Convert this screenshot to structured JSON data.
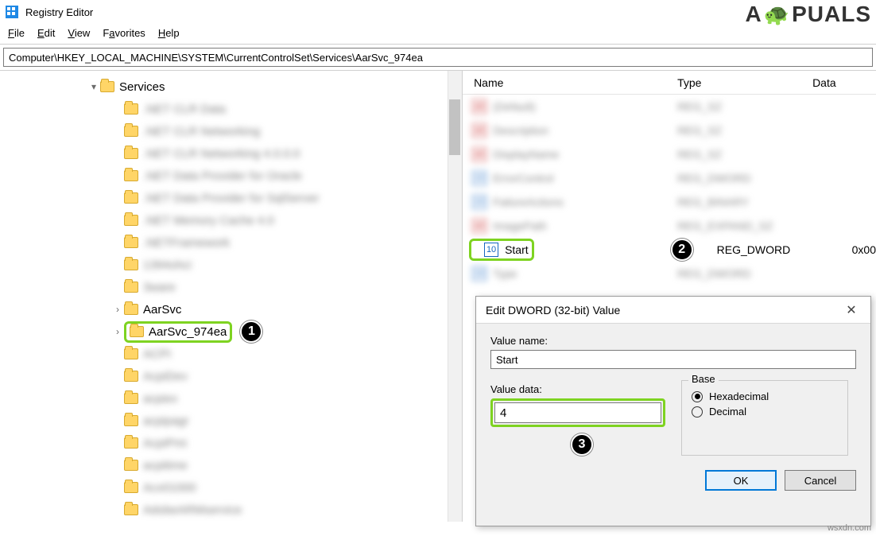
{
  "window": {
    "title": "Registry Editor"
  },
  "menu": {
    "file": "File",
    "edit": "Edit",
    "view": "View",
    "favorites": "Favorites",
    "help": "Help"
  },
  "address": "Computer\\HKEY_LOCAL_MACHINE\\SYSTEM\\CurrentControlSet\\Services\\AarSvc_974ea",
  "tree": {
    "parent": "Services",
    "items": [
      {
        "label": ".NET CLR Data",
        "blurred": true
      },
      {
        "label": ".NET CLR Networking",
        "blurred": true
      },
      {
        "label": ".NET CLR Networking 4.0.0.0",
        "blurred": true
      },
      {
        "label": ".NET Data Provider for Oracle",
        "blurred": true
      },
      {
        "label": ".NET Data Provider for SqlServer",
        "blurred": true
      },
      {
        "label": ".NET Memory Cache 4.0",
        "blurred": true
      },
      {
        "label": ".NETFramework",
        "blurred": true
      },
      {
        "label": "1394ohci",
        "blurred": true
      },
      {
        "label": "3ware",
        "blurred": true
      },
      {
        "label": "AarSvc",
        "blurred": false
      },
      {
        "label": "AarSvc_974ea",
        "blurred": false,
        "highlighted": true,
        "badge": "1"
      },
      {
        "label": "ACPI",
        "blurred": true
      },
      {
        "label": "AcpiDev",
        "blurred": true
      },
      {
        "label": "acpiex",
        "blurred": true
      },
      {
        "label": "acpipagr",
        "blurred": true
      },
      {
        "label": "AcpiPmi",
        "blurred": true
      },
      {
        "label": "acpitime",
        "blurred": true
      },
      {
        "label": "Acx01000",
        "blurred": true
      },
      {
        "label": "AdobeARMservice",
        "blurred": true
      }
    ]
  },
  "values": {
    "columns": {
      "name": "Name",
      "type": "Type",
      "data": "Data"
    },
    "rows": [
      {
        "icon": "str",
        "label": "(Default)",
        "type": "REG_SZ",
        "blurred": true
      },
      {
        "icon": "str",
        "label": "Description",
        "type": "REG_SZ",
        "blurred": true
      },
      {
        "icon": "str",
        "label": "DisplayName",
        "type": "REG_SZ",
        "blurred": true
      },
      {
        "icon": "dword",
        "label": "ErrorControl",
        "type": "REG_DWORD",
        "blurred": true
      },
      {
        "icon": "dword",
        "label": "FailureActions",
        "type": "REG_BINARY",
        "blurred": true
      },
      {
        "icon": "str",
        "label": "ImagePath",
        "type": "REG_EXPAND_SZ",
        "blurred": true
      },
      {
        "icon": "dword",
        "label": "Start",
        "type": "REG_DWORD",
        "data": "0x00",
        "blurred": false,
        "highlighted": true,
        "badge": "2"
      },
      {
        "icon": "dword",
        "label": "Type",
        "type": "REG_DWORD",
        "blurred": true
      }
    ]
  },
  "dialog": {
    "title": "Edit DWORD (32-bit) Value",
    "value_name_label": "Value name:",
    "value_name": "Start",
    "value_data_label": "Value data:",
    "value_data": "4",
    "badge": "3",
    "base_label": "Base",
    "hex_label": "Hexadecimal",
    "dec_label": "Decimal",
    "base_selected": "hex",
    "ok": "OK",
    "cancel": "Cancel"
  },
  "brand": "A  PUALS",
  "watermark": "wsxdn.com"
}
